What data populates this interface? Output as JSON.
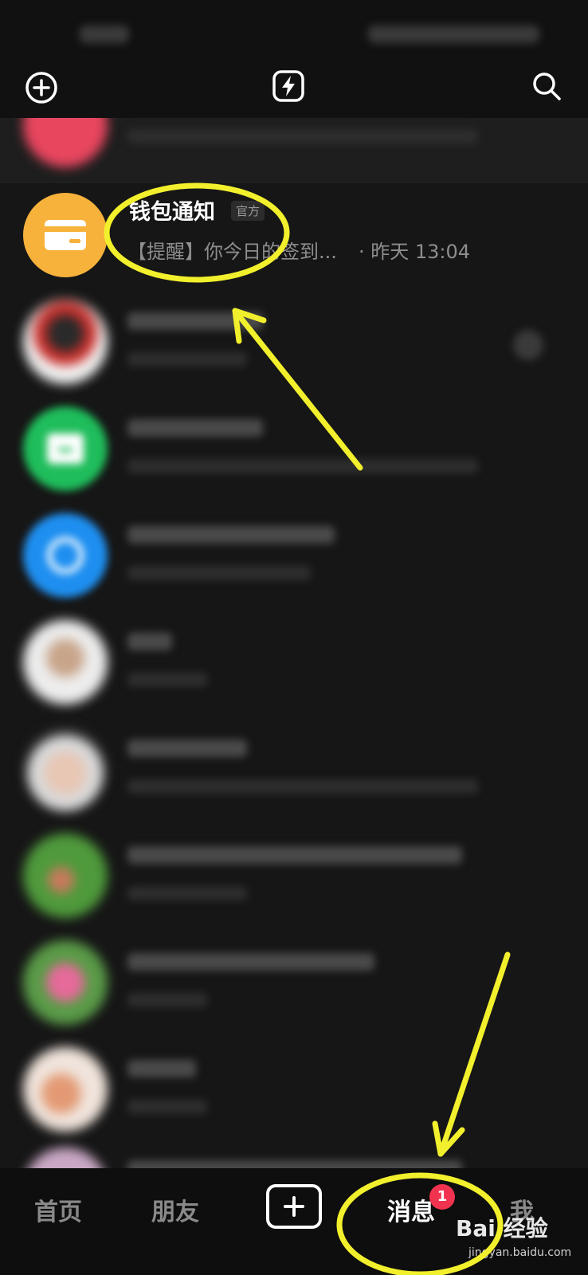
{
  "colors": {
    "background": "#161616",
    "annotation": "#f2f02c",
    "badge": "#f2334f",
    "wallet_avatar": "#f7b23b",
    "green_avatar": "#1fbd5b",
    "blue_avatar": "#1e8ff0"
  },
  "top_bar": {
    "left_icon": "plus-circle-icon",
    "center_icon": "lightning-icon",
    "right_icon": "search-icon"
  },
  "wallet_notice": {
    "title": "钱包通知",
    "tag": "官方",
    "preview": "【提醒】你今日的签到...",
    "time": "· 昨天 13:04",
    "avatar_icon": "card-icon"
  },
  "bottom_nav": {
    "home": "首页",
    "friends": "朋友",
    "create_icon": "plus-icon",
    "messages": "消息",
    "messages_badge": "1",
    "me": "我"
  },
  "watermark": {
    "text": "Bai 经验",
    "sub": "jingyan.baidu.com"
  }
}
